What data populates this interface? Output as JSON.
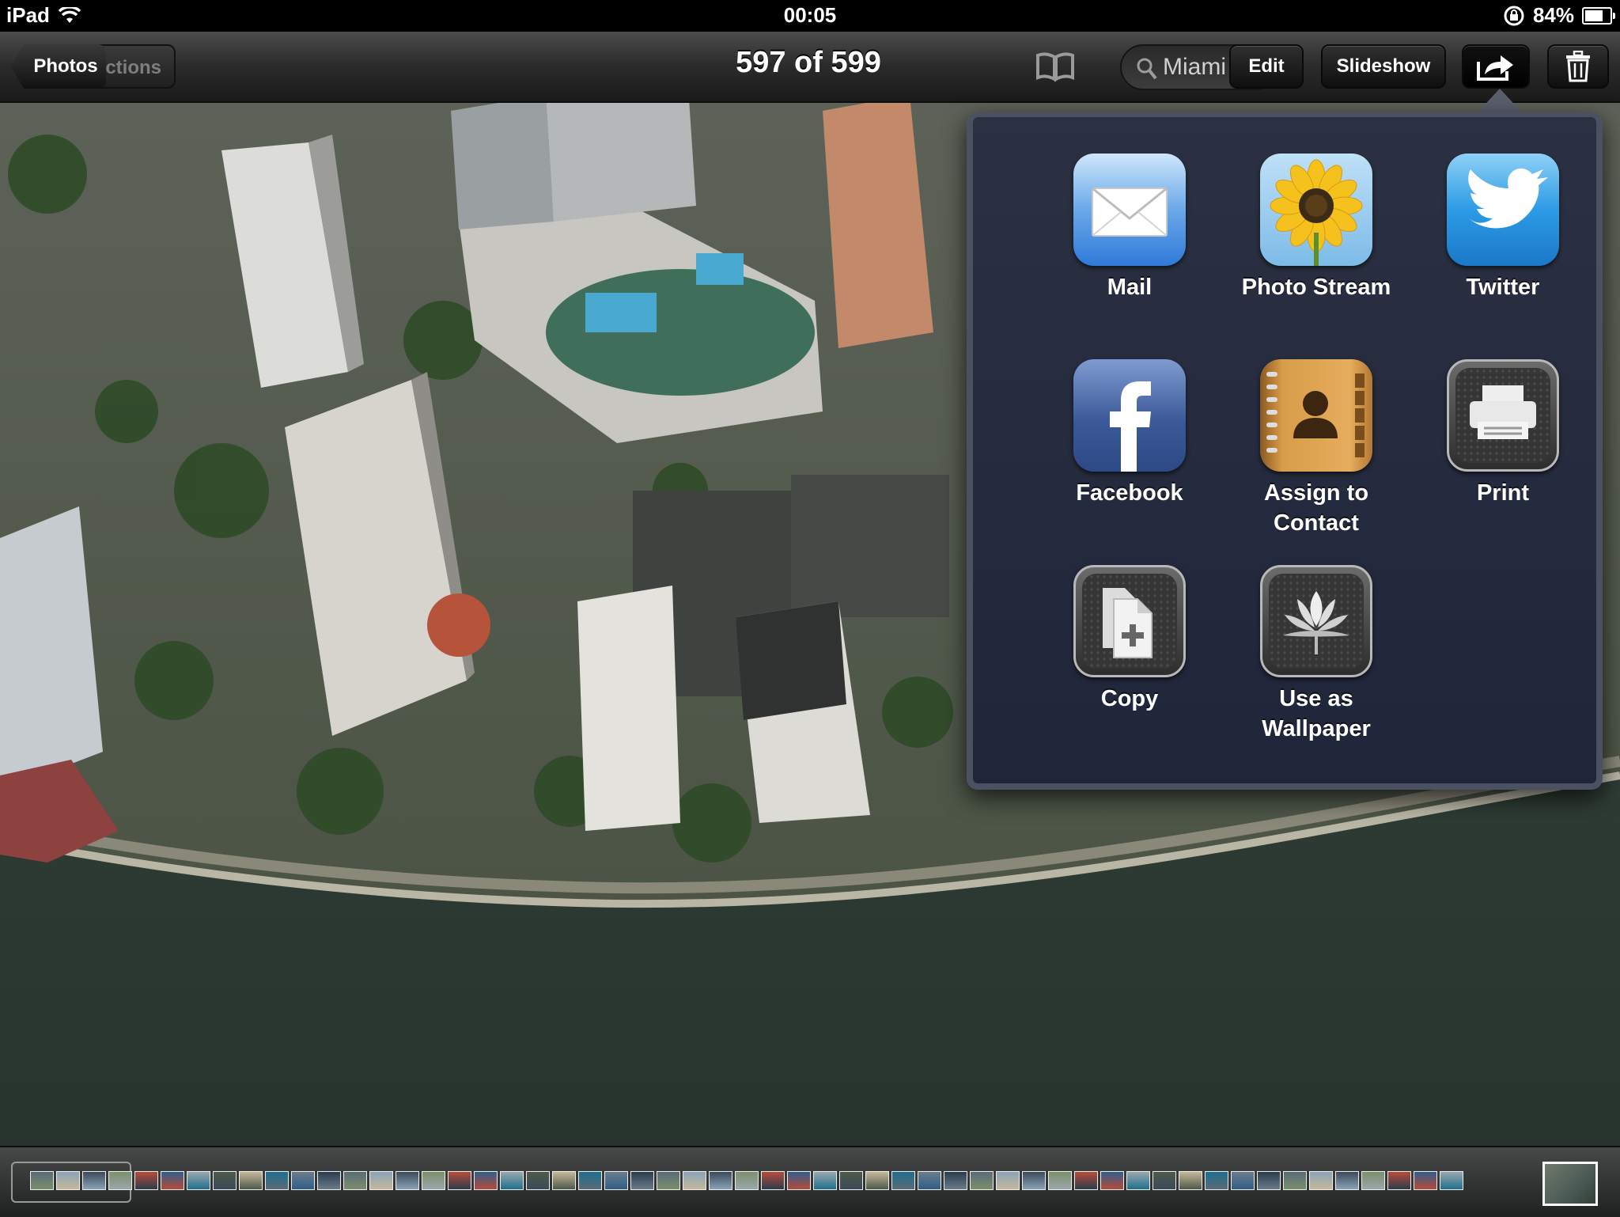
{
  "status_bar": {
    "device": "iPad",
    "time": "00:05",
    "battery": "84%",
    "battery_level": 0.84
  },
  "nav": {
    "back_button": "Photos",
    "collections_button": "ctions",
    "title": "597 of 599",
    "search_text": "Miami",
    "edit": "Edit",
    "slideshow": "Slideshow"
  },
  "share_sheet": {
    "items": [
      {
        "label": "Mail",
        "icon": "mail-icon"
      },
      {
        "label": "Photo Stream",
        "icon": "photo-stream-icon"
      },
      {
        "label": "Twitter",
        "icon": "twitter-icon"
      },
      {
        "label": "Facebook",
        "icon": "facebook-icon"
      },
      {
        "label": "Assign to\nContact",
        "icon": "contact-icon"
      },
      {
        "label": "Print",
        "icon": "print-icon"
      },
      {
        "label": "Copy",
        "icon": "copy-icon"
      },
      {
        "label": "Use as\nWallpaper",
        "icon": "wallpaper-icon"
      }
    ]
  },
  "colors": {
    "popover_bg": "#22283b",
    "popover_border": "#4c5161",
    "navbar": "#2b2b2b",
    "mail_blue": "#2f7ad9",
    "facebook_blue": "#3b5998",
    "twitter_blue": "#1d8fe0"
  }
}
